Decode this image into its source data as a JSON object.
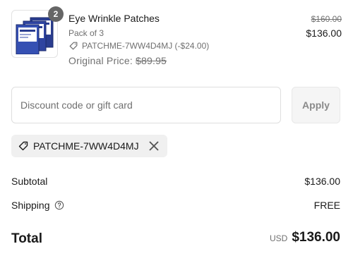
{
  "line_item": {
    "quantity": "2",
    "name": "Eye Wrinkle Patches",
    "variant": "Pack of 3",
    "discount_text": "PATCHME-7WW4D4MJ (-$24.00)",
    "original_price_label": "Original Price:",
    "original_price_value": "$89.95",
    "compare_price": "$160.00",
    "price": "$136.00",
    "thumbnail_icon": "product-pack-image"
  },
  "discount": {
    "placeholder": "Discount code or gift card",
    "value": "",
    "apply_label": "Apply"
  },
  "applied_code": {
    "code": "PATCHME-7WW4D4MJ",
    "tag_icon": "tag-icon",
    "remove_icon": "close-icon"
  },
  "summary": {
    "subtotal_label": "Subtotal",
    "subtotal_value": "$136.00",
    "shipping_label": "Shipping",
    "shipping_value": "FREE",
    "total_label": "Total",
    "currency": "USD",
    "total_value": "$136.00"
  },
  "colors": {
    "text": "#1a1a1a",
    "muted": "#707070",
    "badge": "#666666",
    "chip_bg": "#f0f0f0",
    "button_bg": "#f5f5f5"
  }
}
